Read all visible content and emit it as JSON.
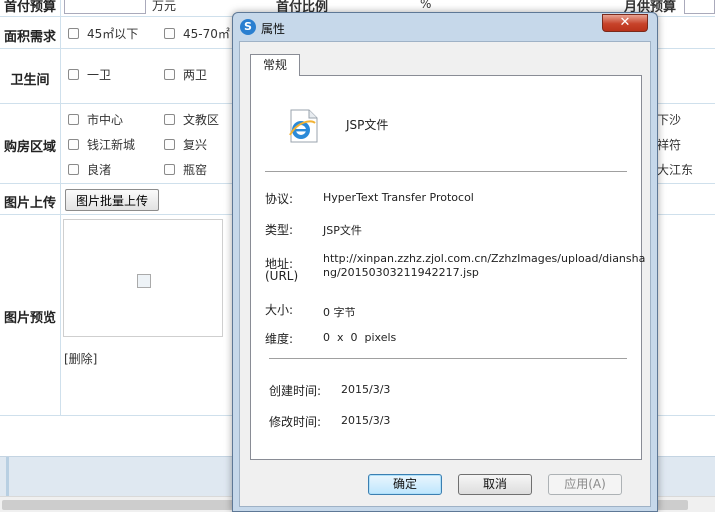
{
  "background_form": {
    "top_row": {
      "label": "首付预算",
      "unit": "万元",
      "ratio_label": "首付比例",
      "ratio_unit": "%",
      "monthly_label": "月供预算"
    },
    "area": {
      "label": "面积需求",
      "options": [
        "45㎡以下",
        "45-70㎡"
      ]
    },
    "bathroom": {
      "label": "卫生间",
      "options": [
        "一卫",
        "两卫"
      ]
    },
    "region": {
      "label": "购房区域",
      "col1": [
        "市中心",
        "钱江新城",
        "良渚"
      ],
      "col2": [
        "文教区",
        "复兴",
        "瓶窑"
      ],
      "right_fragments": [
        "下沙",
        "祥符",
        "大江东"
      ]
    },
    "upload": {
      "label": "图片上传",
      "button": "图片批量上传"
    },
    "preview": {
      "label": "图片预览",
      "delete": "[删除]"
    }
  },
  "dialog": {
    "title": "属性",
    "app_icon_letter": "S",
    "close_label": "✕",
    "tab": "常规",
    "file_name": "JSP文件",
    "protocol_label": "协议:",
    "protocol_value": "HyperText Transfer Protocol",
    "type_label": "类型:",
    "type_value": "JSP文件",
    "address_label_1": "地址:",
    "address_label_2": "(URL)",
    "address_line_1": "http://xinpan.zzhz.zjol.com.cn/ZzhzImages/upload/diansha",
    "address_line_2": "ng/20150303211942217.jsp",
    "size_label": "大小:",
    "size_value": "0 字节",
    "dimensions_label": "维度:",
    "dimensions_value": "0  x  0  pixels",
    "created_label": "创建时间:",
    "created_value": "2015/3/3",
    "modified_label": "修改时间:",
    "modified_value": "2015/3/3",
    "buttons": {
      "ok": "确定",
      "cancel": "取消",
      "apply": "应用(A)"
    }
  },
  "colors": {
    "dialog_frame": "#c6d8ea",
    "close_button": "#c7432a",
    "grid_line": "#cfe0ec",
    "bottom_bar": "#dfe8f1"
  }
}
